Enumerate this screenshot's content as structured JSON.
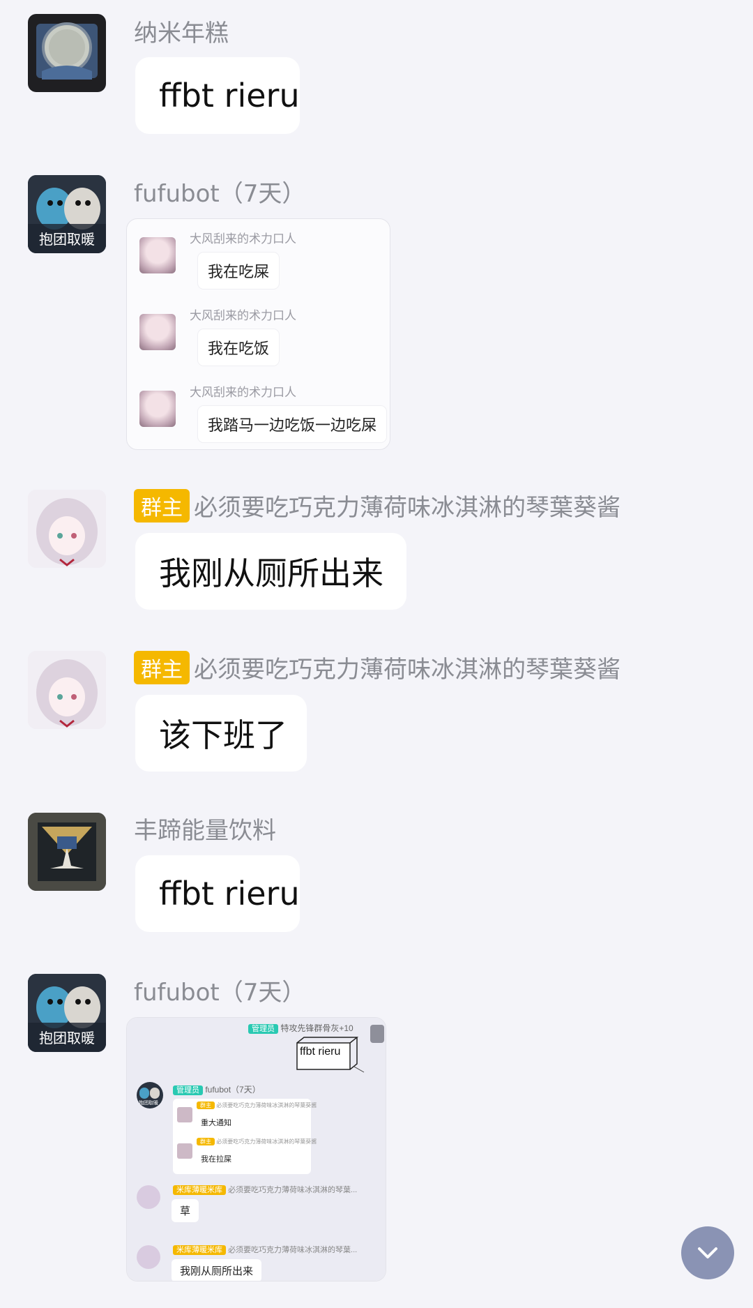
{
  "messages": [
    {
      "sender": "纳米年糕",
      "text": "ffbt rieru",
      "avatar_icon": "moon-plate-avatar"
    },
    {
      "sender": "fufubot（7天）",
      "avatar_label": "抱团取暖",
      "forwarded": [
        {
          "name": "大风刮来的术力口人",
          "text": "我在吃屎"
        },
        {
          "name": "大风刮来的术力口人",
          "text": "我在吃饭"
        },
        {
          "name": "大风刮来的术力口人",
          "text": "我踏马一边吃饭一边吃屎"
        }
      ]
    },
    {
      "badge": "群主",
      "sender": "必须要吃巧克力薄荷味冰淇淋的琴葉葵酱",
      "text": "我刚从厕所出来"
    },
    {
      "badge": "群主",
      "sender": "必须要吃巧克力薄荷味冰淇淋的琴葉葵酱",
      "text": "该下班了"
    },
    {
      "sender": "丰蹄能量饮料",
      "text": "ffbt rieru"
    },
    {
      "sender": "fufubot（7天）",
      "avatar_label": "抱团取暖",
      "screenshot": {
        "top_badge": "管理员",
        "top_name": "特攻先锋群骨灰+10",
        "box_text": "ffbt rieru",
        "bot_badge": "管理员",
        "bot_name": "fufubot（7天）",
        "bot_avatar_label": "抱团取暖",
        "inner_items": [
          {
            "badge": "群主",
            "name": "必须要吃巧克力薄荷味冰淇淋的琴葉葵酱",
            "text": "重大通知"
          },
          {
            "badge": "群主",
            "name": "必须要吃巧克力薄荷味冰淇淋的琴葉葵酱",
            "text": "我在拉屎"
          }
        ],
        "replies": [
          {
            "badge": "米库薄暖米库",
            "name": "必须要吃巧克力薄荷味冰淇淋的琴葉...",
            "text": "草"
          },
          {
            "badge": "米库薄暖米库",
            "name": "必须要吃巧克力薄荷味冰淇淋的琴葉...",
            "text": "我刚从厕所出来"
          }
        ]
      }
    }
  ],
  "colors": {
    "background": "#f4f4f9",
    "owner_badge": "#f5b800",
    "admin_badge": "#29c9b2",
    "fab": "#8a93b4"
  },
  "scroll_button_icon": "chevron-down-icon"
}
